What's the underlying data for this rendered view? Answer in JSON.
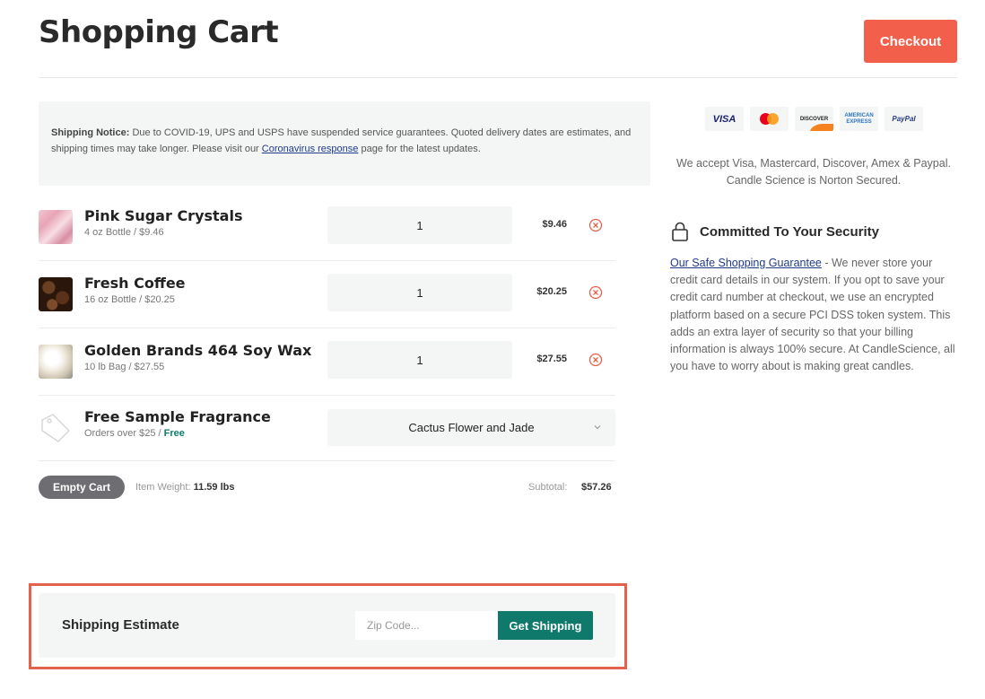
{
  "header": {
    "title": "Shopping Cart",
    "checkout_label": "Checkout"
  },
  "notice": {
    "label": "Shipping Notice:",
    "text_before": " Due to COVID-19, UPS and USPS have suspended service guarantees. Quoted delivery dates are estimates, and shipping times may take longer. Please visit our ",
    "link": "Coronavirus response",
    "text_after": " page for the latest updates."
  },
  "items": [
    {
      "name": "Pink Sugar Crystals",
      "sub": "4 oz Bottle / $9.46",
      "qty": "1",
      "price": "$9.46",
      "thumb": "pink-sugar-image"
    },
    {
      "name": "Fresh Coffee",
      "sub": "16 oz Bottle / $20.25",
      "qty": "1",
      "price": "$20.25",
      "thumb": "coffee-beans-image"
    },
    {
      "name": "Golden Brands 464 Soy Wax",
      "sub": "10 lb Bag / $27.55",
      "qty": "1",
      "price": "$27.55",
      "thumb": "soy-wax-image"
    }
  ],
  "sample": {
    "name": "Free Sample Fragrance",
    "sub_prefix": "Orders over $25 / ",
    "sub_free": "Free",
    "selected": "Cactus Flower and Jade",
    "icon": "tag-icon"
  },
  "summary": {
    "empty_label": "Empty Cart",
    "weight_label": "Item Weight:",
    "weight_value": "11.59 lbs",
    "subtotal_label": "Subtotal:",
    "subtotal_value": "$57.26"
  },
  "shipping": {
    "title": "Shipping Estimate",
    "zip_placeholder": "Zip Code...",
    "button_label": "Get Shipping"
  },
  "payment": {
    "cards": [
      "VISA",
      "MasterCard",
      "DISCOVER",
      "AMERICAN EXPRESS",
      "PayPal"
    ],
    "accept_line1": "We accept Visa, Mastercard, Discover, Amex & Paypal.",
    "accept_line2": "Candle Science is Norton Secured."
  },
  "security": {
    "title": "Committed To Your Security",
    "icon": "lock-icon",
    "link": "Our Safe Shopping Guarantee",
    "text": " - We never store your credit card details in our system. If you opt to save your credit card number at checkout, we use an encrypted platform based on a secure PCI DSS token system. This adds an extra layer of security so that your billing information is always 100% secure. At CandleScience, all you have to worry about is making great candles."
  },
  "colors": {
    "accent": "#f2604b",
    "teal": "#0f7a6b",
    "highlight_outline": "#e2624b"
  }
}
